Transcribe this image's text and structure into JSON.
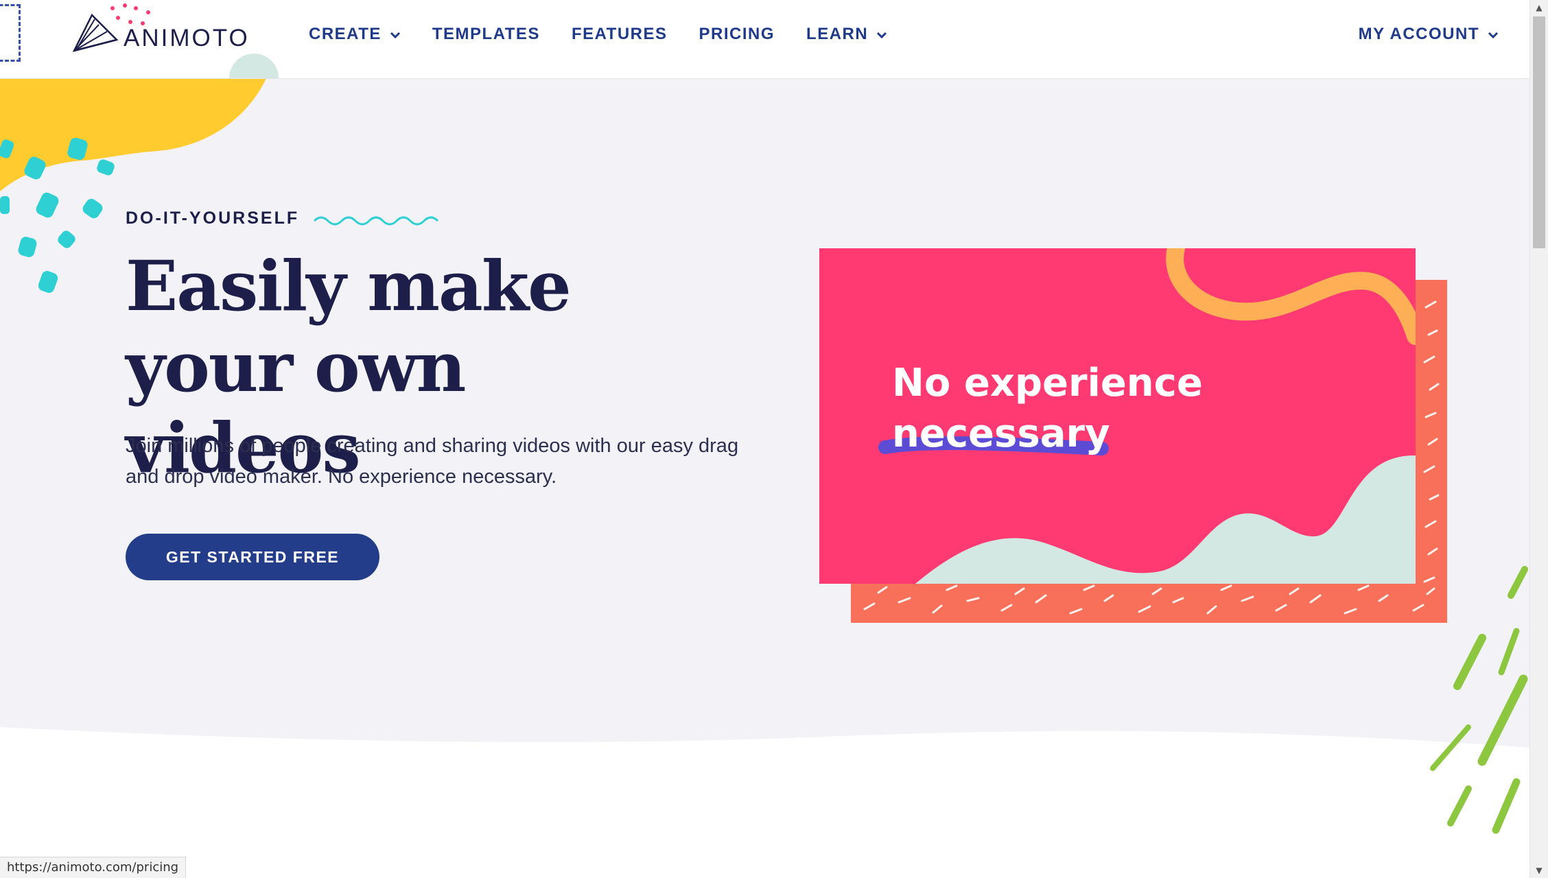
{
  "brand": {
    "name": "ANIMOTO"
  },
  "nav": {
    "items": [
      {
        "label": "CREATE",
        "has_dropdown": true
      },
      {
        "label": "TEMPLATES",
        "has_dropdown": false
      },
      {
        "label": "FEATURES",
        "has_dropdown": false
      },
      {
        "label": "PRICING",
        "has_dropdown": false
      },
      {
        "label": "LEARN",
        "has_dropdown": true
      }
    ],
    "account": {
      "label": "MY ACCOUNT",
      "has_dropdown": true
    }
  },
  "hero": {
    "eyebrow": "DO-IT-YOURSELF",
    "headline": "Easily make your own videos",
    "subtext": "Join millions of people creating and sharing videos with our easy drag and drop video maker. No experience necessary.",
    "cta_label": "GET STARTED FREE"
  },
  "illustration": {
    "line1": "No experience",
    "line2": "necessary"
  },
  "status_bar": {
    "url": "https://animoto.com/pricing"
  },
  "colors": {
    "navy": "#1d1f4a",
    "nav_blue": "#1f3a8a",
    "cta_blue": "#233d8b",
    "pink": "#ff3a72",
    "coral": "#f8705a",
    "yellow": "#ffcb2f",
    "teal": "#2fd0d3",
    "mint": "#d3e8e3",
    "orange": "#ffb056",
    "lime": "#8dc63f",
    "background": "#f2f2f7"
  },
  "icons": [
    "animoto-logo-icon",
    "chevron-down-icon",
    "squiggle-icon"
  ]
}
